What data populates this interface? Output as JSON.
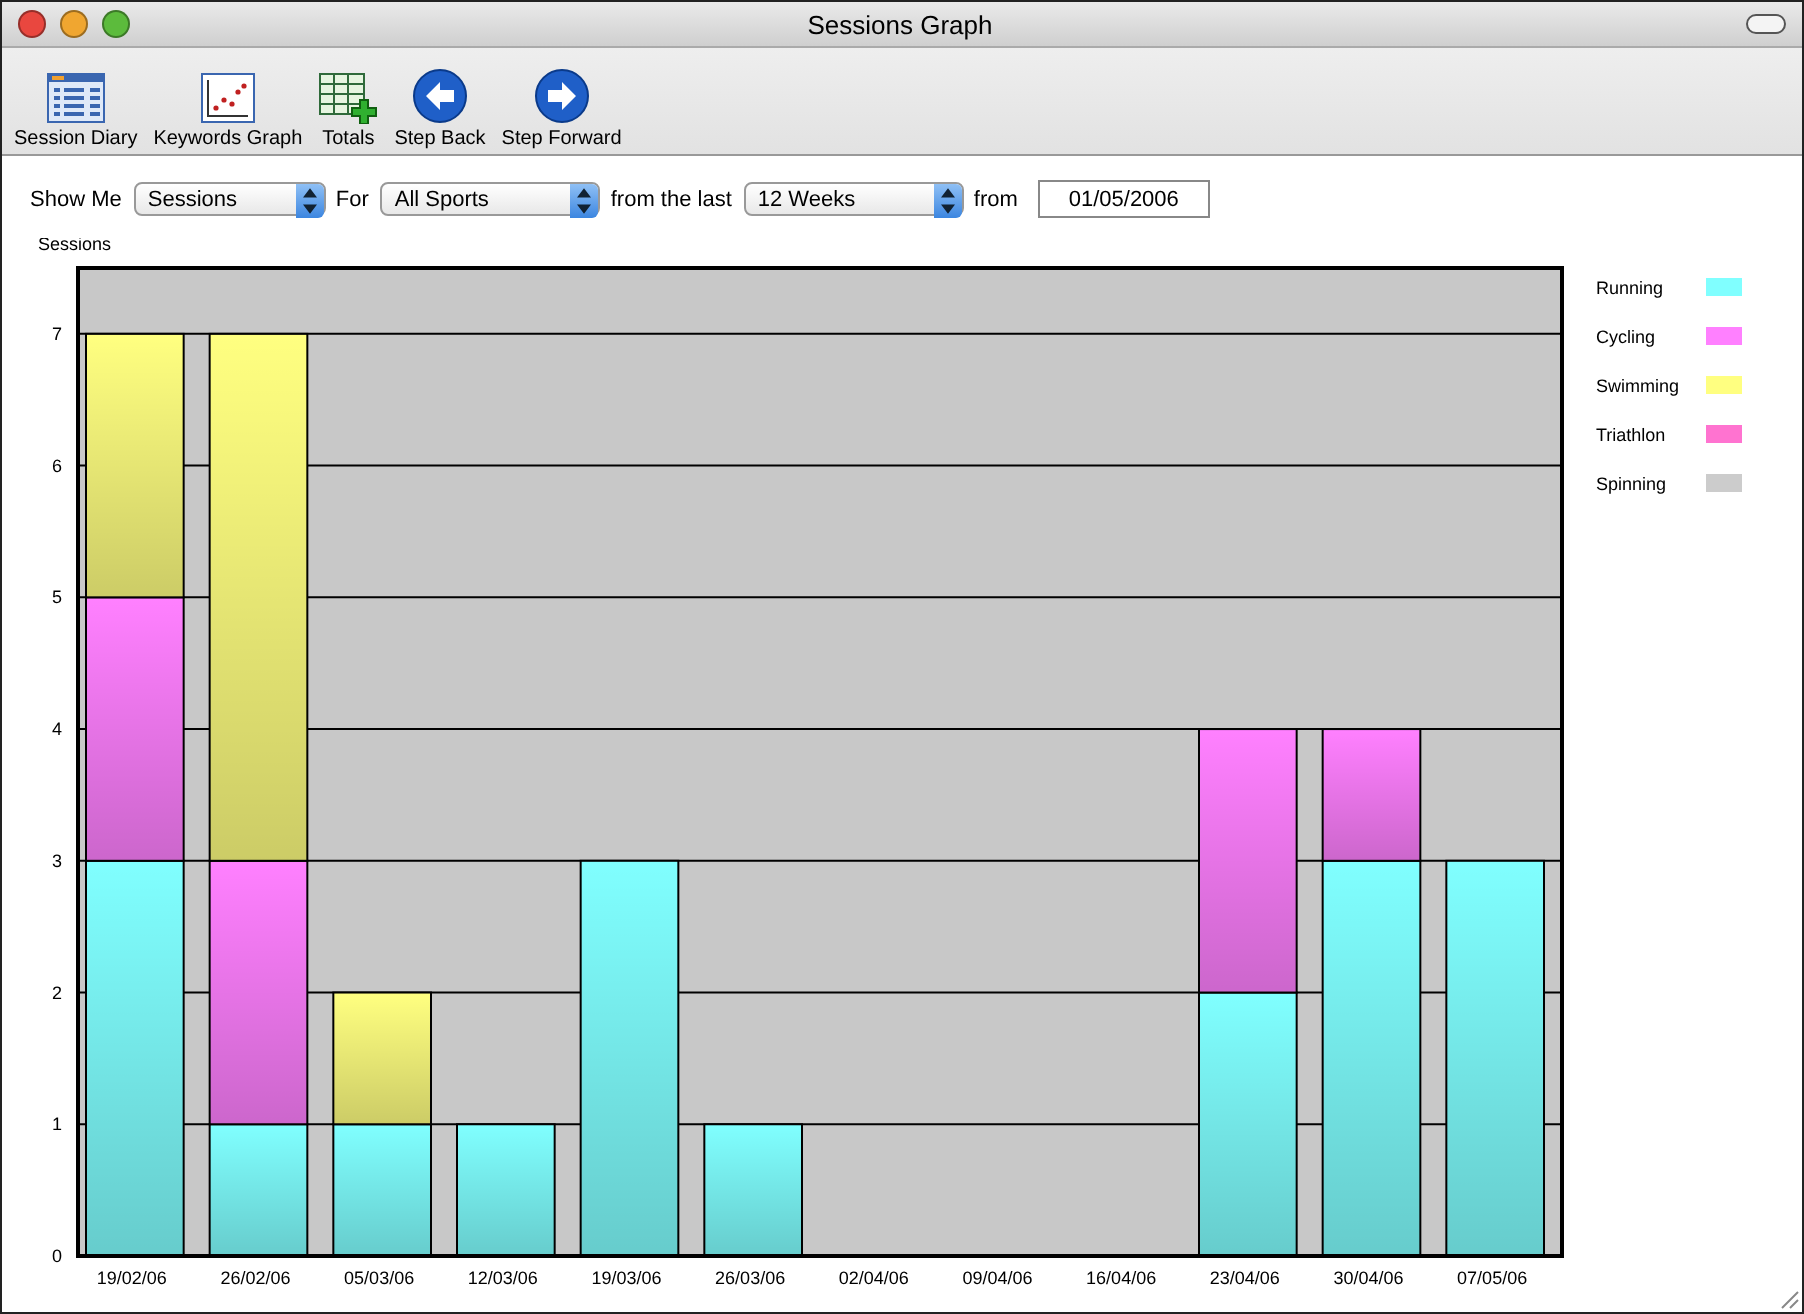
{
  "window": {
    "title": "Sessions Graph"
  },
  "toolbar": [
    {
      "label": "Session Diary",
      "kind": "diary"
    },
    {
      "label": "Keywords Graph",
      "kind": "scatter"
    },
    {
      "label": "Totals",
      "kind": "totals"
    },
    {
      "label": "Step Back",
      "kind": "back"
    },
    {
      "label": "Step Forward",
      "kind": "forward"
    }
  ],
  "filters": {
    "show_me_label": "Show Me",
    "show_me": "Sessions",
    "for_label": "For",
    "sport": "All Sports",
    "from_last_label": "from the last",
    "period": "12 Weeks",
    "from_label": "from",
    "date": "01/05/2006"
  },
  "chart": {
    "chart_data": {
      "type": "bar",
      "stacked": true,
      "grid": true,
      "legend": "right",
      "ylabel": "Sessions",
      "categories": [
        "19/02/06",
        "26/02/06",
        "05/03/06",
        "12/03/06",
        "19/03/06",
        "26/03/06",
        "02/04/06",
        "09/04/06",
        "16/04/06",
        "23/04/06",
        "30/04/06",
        "07/05/06"
      ],
      "ylim": [
        0,
        7.5
      ],
      "yticks": [
        0,
        1,
        2,
        3,
        4,
        5,
        6,
        7
      ],
      "series": [
        {
          "name": "Running",
          "color": "#80ffff",
          "values": [
            3,
            1,
            1,
            1,
            3,
            1,
            0,
            0,
            0,
            2,
            3,
            3
          ]
        },
        {
          "name": "Cycling",
          "color": "#ff80ff",
          "values": [
            2,
            2,
            0,
            0,
            0,
            0,
            0,
            0,
            0,
            2,
            1,
            0
          ]
        },
        {
          "name": "Swimming",
          "color": "#ffff80",
          "values": [
            2,
            4,
            1,
            0,
            0,
            0,
            0,
            0,
            0,
            0,
            0,
            0
          ]
        },
        {
          "name": "Triathlon",
          "color": "#ff73d0",
          "values": [
            0,
            0,
            0,
            0,
            0,
            0,
            0,
            0,
            0,
            0,
            0,
            0
          ]
        },
        {
          "name": "Spinning",
          "color": "#cccccc",
          "values": [
            0,
            0,
            0,
            0,
            0,
            0,
            0,
            0,
            0,
            0,
            0,
            0
          ]
        }
      ]
    }
  }
}
